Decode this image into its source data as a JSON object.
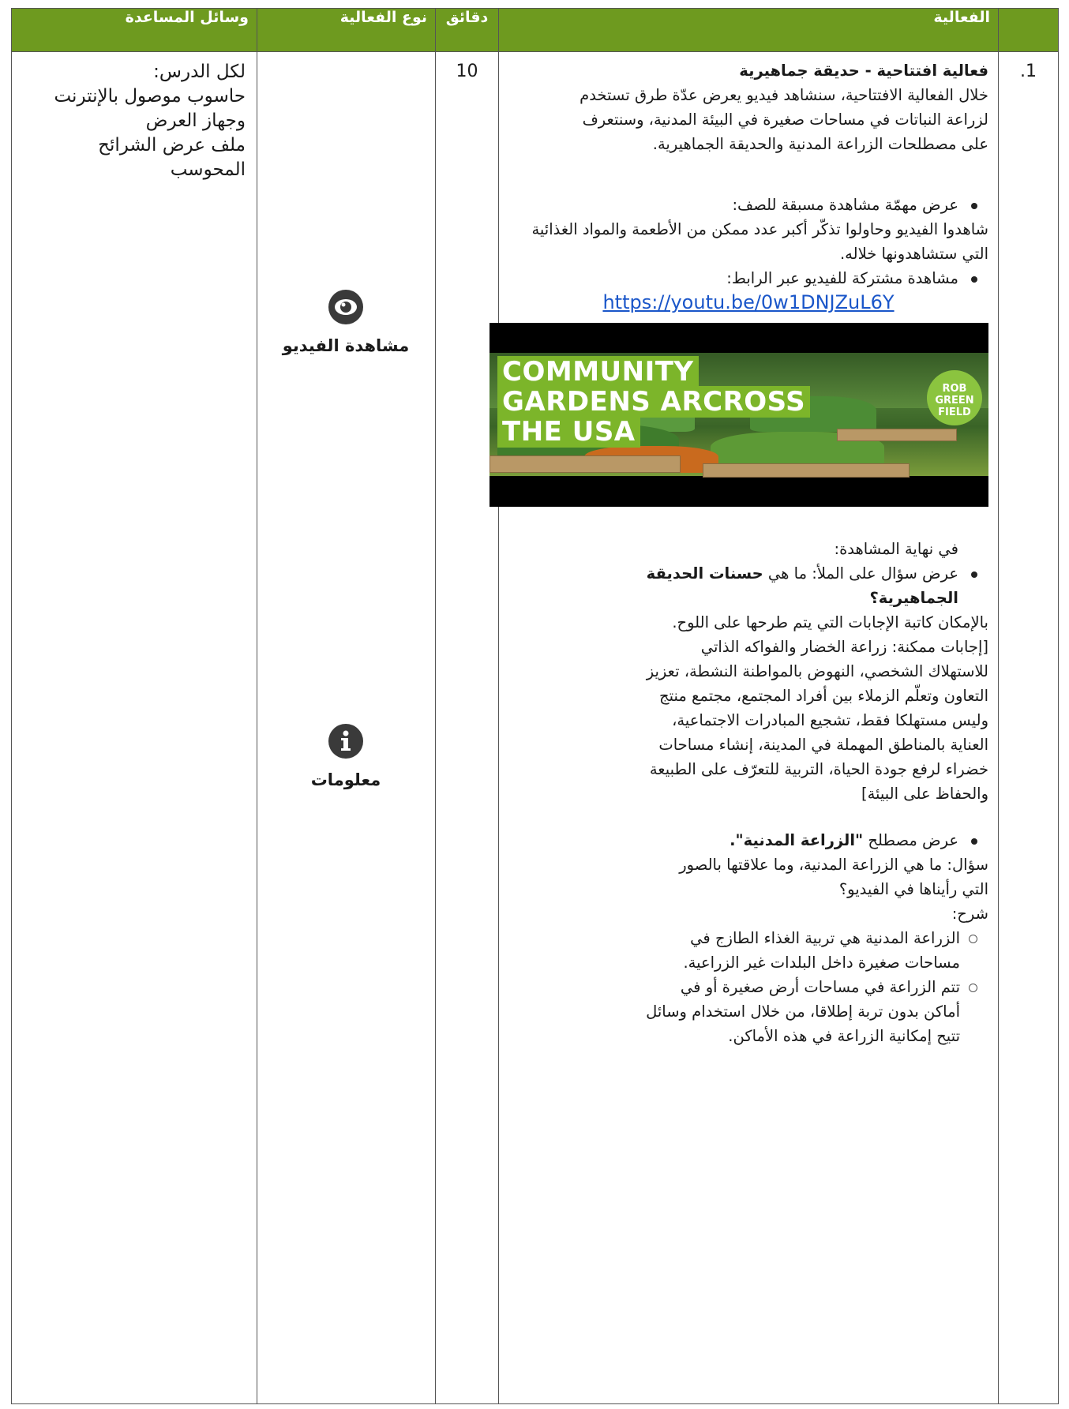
{
  "headers": {
    "activity": "الفعالية",
    "minutes": "دقائق",
    "type": "نوع الفعالية",
    "aids": "وسائل المساعدة"
  },
  "row": {
    "number": "1.",
    "minutes": "10",
    "aids_lines": [
      "لكل الدرس:",
      "حاسوب موصول بالإنترنت",
      "وجهاز العرض",
      "ملف عرض الشرائح",
      "المحوسب"
    ],
    "types": [
      {
        "icon": "eye-icon",
        "label": "مشاهدة الفيديو"
      },
      {
        "icon": "info-icon",
        "label": "معلومات"
      }
    ],
    "activity": {
      "title": "فعالية افتتاحية - حديقة جماهيرية",
      "intro": "خلال الفعالية الافتتاحية، سنشاهد فيديو يعرض عدّة طرق تستخدم لزراعة النباتات في مساحات صغيرة في البيئة المدنية، وسنتعرف على مصطلحات الزراعة المدنية والحديقة الجماهيرية.",
      "bullet1_title": "عرض مهمّة مشاهدة مسبقة للصف:",
      "bullet1_body": "شاهدوا الفيديو وحاولوا تذكّر أكبر عدد ممكن من الأطعمة والمواد الغذائية التي ستشاهدونها خلاله.",
      "bullet2": "مشاهدة مشتركة للفيديو عبر الرابط:",
      "link": "https://youtu.be/0w1DNJZuL6Y",
      "video_title_1": "COMMUNITY",
      "video_title_2": "GARDENS ARCROSS",
      "video_title_3": "THE USA",
      "video_badge": "ROB GREEN FIELD",
      "end_watch": "في نهاية المشاهدة:",
      "bullet3_pre": "عرض سؤال على الملأ: ما هي ",
      "bullet3_bold": "حسنات الحديقة الجماهيرية؟",
      "bullet3_body": "بالإمكان كاتبة الإجابات التي يتم طرحها على اللوح.",
      "answers": "[إجابات ممكنة: زراعة الخضار والفواكه الذاتي للاستهلاك الشخصي، النهوض بالمواطنة النشطة، تعزيز التعاون وتعلّم الزملاء بين أفراد المجتمع، مجتمع منتج وليس مستهلكا فقط، تشجيع المبادرات الاجتماعية، العناية بالمناطق المهملة في المدينة، إنشاء مساحات خضراء لرفع جودة الحياة، التربية للتعرّف على الطبيعة والحفاظ على البيئة]",
      "bullet4_pre": "عرض مصطلح ",
      "bullet4_bold": "\"الزراعة المدنية\".",
      "bullet4_q": "سؤال: ما هي الزراعة المدنية، وما علاقتها بالصور التي رأيناها في الفيديو؟",
      "bullet4_exp": "شرح:",
      "sub1": "الزراعة المدنية هي تربية الغذاء الطازج في مساحات صغيرة داخل البلدات غير الزراعية.",
      "sub2": "تتم الزراعة في مساحات أرض صغيرة أو في أماكن بدون تربة إطلاقا، من خلال استخدام وسائل تتيح إمكانية الزراعة في هذه الأماكن."
    }
  },
  "colors": {
    "header_bg": "#6e9a1f",
    "link": "#1a56c9",
    "video_accent": "#7cb52a"
  }
}
